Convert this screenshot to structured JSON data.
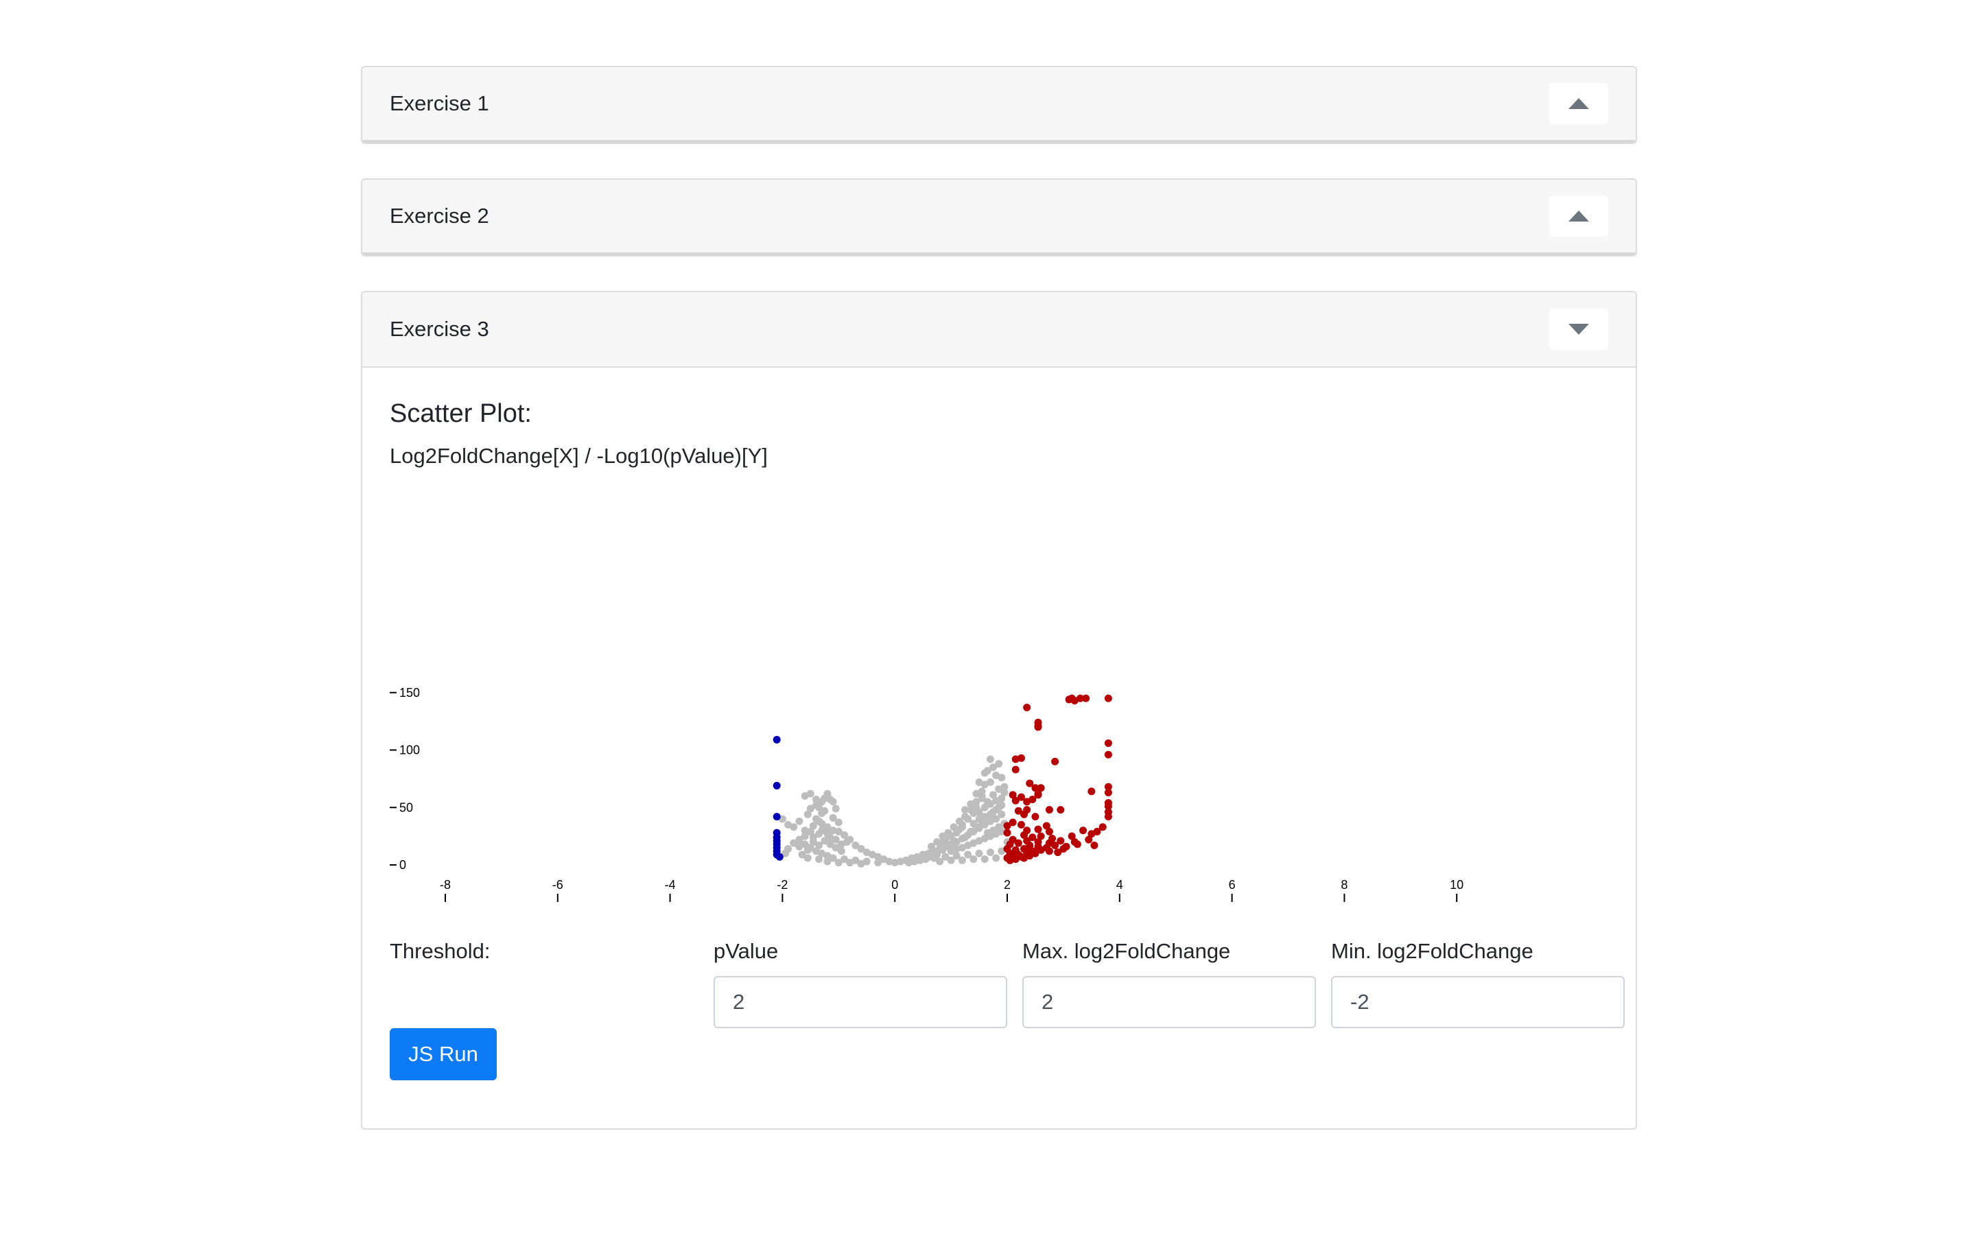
{
  "exercises": [
    {
      "title": "Exercise 1",
      "toggle_icon": "chevron-up-icon",
      "expanded": false
    },
    {
      "title": "Exercise 2",
      "toggle_icon": "chevron-up-icon",
      "expanded": false
    },
    {
      "title": "Exercise 3",
      "toggle_icon": "chevron-down-icon",
      "expanded": true
    }
  ],
  "plot": {
    "heading": "Scatter Plot:",
    "subtitle": "Log2FoldChange[X] / -Log10(pValue)[Y]"
  },
  "threshold": {
    "label": "Threshold:",
    "pvalue_label": "pValue",
    "pvalue_value": "2",
    "max_label": "Max. log2FoldChange",
    "max_value": "2",
    "min_label": "Min. log2FoldChange",
    "min_value": "-2",
    "run_label": "JS Run"
  },
  "colors": {
    "accent": "#0d7bf5",
    "not_significant": "#bdbdbd",
    "down_regulated": "#0000b8",
    "up_regulated": "#b80000"
  },
  "chart_data": {
    "type": "scatter",
    "title": "",
    "xlabel": "",
    "ylabel": "",
    "xlim": [
      -8,
      10
    ],
    "ylim": [
      0,
      150
    ],
    "x_ticks": [
      "-8",
      "-6",
      "-4",
      "-2",
      "0",
      "2",
      "4",
      "6",
      "8",
      "10"
    ],
    "y_ticks": [
      "0",
      "50",
      "100",
      "150"
    ],
    "series": [
      {
        "color": "#0000b8",
        "points": [
          [
            -2.1,
            109
          ],
          [
            -2.1,
            69
          ],
          [
            -2.1,
            42
          ],
          [
            -2.1,
            28
          ],
          [
            -2.1,
            24
          ],
          [
            -2.1,
            21
          ],
          [
            -2.1,
            18
          ],
          [
            -2.1,
            15
          ],
          [
            -2.1,
            12
          ],
          [
            -2.1,
            9
          ],
          [
            -2.05,
            7
          ]
        ]
      },
      {
        "color": "#b80000",
        "points": [
          [
            3.1,
            144
          ],
          [
            3.15,
            145
          ],
          [
            3.3,
            145
          ],
          [
            3.4,
            145
          ],
          [
            3.8,
            145
          ],
          [
            3.2,
            143
          ],
          [
            2.35,
            137
          ],
          [
            2.55,
            124
          ],
          [
            2.55,
            121
          ],
          [
            2.55,
            120
          ],
          [
            3.8,
            106
          ],
          [
            3.8,
            96
          ],
          [
            2.15,
            92
          ],
          [
            2.25,
            93
          ],
          [
            2.85,
            90
          ],
          [
            2.15,
            83
          ],
          [
            2.4,
            71
          ],
          [
            2.5,
            67
          ],
          [
            2.6,
            67
          ],
          [
            2.55,
            62
          ],
          [
            3.5,
            64
          ],
          [
            3.8,
            68
          ],
          [
            3.8,
            63
          ],
          [
            2.1,
            61
          ],
          [
            2.25,
            59
          ],
          [
            2.35,
            55
          ],
          [
            2.45,
            57
          ],
          [
            2.55,
            61
          ],
          [
            2.15,
            56
          ],
          [
            3.8,
            54
          ],
          [
            3.8,
            51
          ],
          [
            2.2,
            47
          ],
          [
            2.35,
            48
          ],
          [
            2.75,
            48
          ],
          [
            2.95,
            48
          ],
          [
            3.8,
            46
          ],
          [
            2.3,
            44
          ],
          [
            2.5,
            42
          ],
          [
            3.8,
            42
          ],
          [
            2.1,
            37
          ],
          [
            2.25,
            35
          ],
          [
            3.7,
            33
          ],
          [
            2.7,
            34
          ],
          [
            2.0,
            34
          ],
          [
            2.35,
            30
          ],
          [
            2.55,
            31
          ],
          [
            2.75,
            29
          ],
          [
            3.35,
            30
          ],
          [
            3.6,
            29
          ],
          [
            2.0,
            28
          ],
          [
            2.3,
            26
          ],
          [
            2.45,
            24
          ],
          [
            2.6,
            25
          ],
          [
            2.8,
            23
          ],
          [
            3.15,
            25
          ],
          [
            3.5,
            27
          ],
          [
            2.1,
            22
          ],
          [
            2.35,
            21
          ],
          [
            2.55,
            20
          ],
          [
            2.75,
            19
          ],
          [
            2.95,
            21
          ],
          [
            3.2,
            20
          ],
          [
            3.45,
            22
          ],
          [
            2.05,
            18
          ],
          [
            2.2,
            19
          ],
          [
            2.4,
            17
          ],
          [
            2.55,
            16
          ],
          [
            2.7,
            15
          ],
          [
            2.85,
            17
          ],
          [
            3.05,
            16
          ],
          [
            3.25,
            18
          ],
          [
            3.55,
            17
          ],
          [
            2.0,
            14
          ],
          [
            2.15,
            13
          ],
          [
            2.3,
            14
          ],
          [
            2.45,
            12
          ],
          [
            2.6,
            13
          ],
          [
            2.75,
            12
          ],
          [
            2.9,
            11
          ],
          [
            3.0,
            14
          ],
          [
            2.05,
            10
          ],
          [
            2.2,
            9
          ],
          [
            2.35,
            11
          ],
          [
            2.5,
            10
          ],
          [
            2.1,
            8
          ],
          [
            2.25,
            7
          ],
          [
            2.4,
            8
          ],
          [
            2.0,
            6
          ],
          [
            2.15,
            5
          ],
          [
            2.3,
            6
          ],
          [
            2.05,
            4
          ]
        ]
      },
      {
        "color": "#bdbdbd",
        "points": [
          [
            -2.0,
            40
          ],
          [
            -1.9,
            35
          ],
          [
            -1.8,
            33
          ],
          [
            -1.7,
            38
          ],
          [
            -1.6,
            30
          ],
          [
            -1.5,
            29
          ],
          [
            -1.7,
            22
          ],
          [
            -1.6,
            25
          ],
          [
            -1.8,
            19
          ],
          [
            -1.9,
            14
          ],
          [
            -1.95,
            10
          ],
          [
            -1.7,
            16
          ],
          [
            -1.55,
            13
          ],
          [
            -1.65,
            9
          ],
          [
            -1.45,
            24
          ],
          [
            -1.35,
            27
          ],
          [
            -1.55,
            44
          ],
          [
            -1.4,
            40
          ],
          [
            -1.3,
            36
          ],
          [
            -1.2,
            33
          ],
          [
            -1.35,
            50
          ],
          [
            -1.25,
            47
          ],
          [
            -1.4,
            52
          ],
          [
            -1.3,
            45
          ],
          [
            -1.5,
            49
          ],
          [
            -1.6,
            60
          ],
          [
            -1.5,
            62
          ],
          [
            -1.2,
            62
          ],
          [
            -1.15,
            57
          ],
          [
            -1.1,
            55
          ],
          [
            -1.05,
            49
          ],
          [
            -1.3,
            55
          ],
          [
            -1.25,
            58
          ],
          [
            -1.4,
            57
          ],
          [
            -1.1,
            41
          ],
          [
            -1.0,
            37
          ],
          [
            -1.0,
            29
          ],
          [
            -0.9,
            26
          ],
          [
            -0.8,
            22
          ],
          [
            -0.85,
            20
          ],
          [
            -0.7,
            17
          ],
          [
            -0.6,
            14
          ],
          [
            -0.5,
            11
          ],
          [
            -0.4,
            9
          ],
          [
            -0.3,
            7
          ],
          [
            -0.2,
            5
          ],
          [
            -0.1,
            3
          ],
          [
            0,
            2
          ],
          [
            0.1,
            3
          ],
          [
            0.2,
            4
          ],
          [
            0.3,
            6
          ],
          [
            0.4,
            7
          ],
          [
            0.5,
            9
          ],
          [
            -1.6,
            18
          ],
          [
            -1.5,
            15
          ],
          [
            -1.45,
            20
          ],
          [
            -1.35,
            17
          ],
          [
            -1.25,
            21
          ],
          [
            -1.15,
            18
          ],
          [
            -1.05,
            15
          ],
          [
            -0.95,
            12
          ],
          [
            -1.4,
            12
          ],
          [
            -1.3,
            10
          ],
          [
            -1.2,
            8
          ],
          [
            -1.1,
            6
          ],
          [
            -0.9,
            5
          ],
          [
            -0.7,
            4
          ],
          [
            -0.5,
            3
          ],
          [
            -0.3,
            2
          ],
          [
            -1.55,
            6
          ],
          [
            -1.35,
            5
          ],
          [
            -1.2,
            3
          ],
          [
            -1.0,
            2
          ],
          [
            -0.8,
            2
          ],
          [
            -0.6,
            1
          ],
          [
            -1.3,
            30
          ],
          [
            -1.2,
            27
          ],
          [
            -1.15,
            24
          ],
          [
            -1.05,
            22
          ],
          [
            -0.95,
            18
          ],
          [
            -1.45,
            34
          ],
          [
            -1.35,
            38
          ],
          [
            -1.25,
            31
          ],
          [
            -1.1,
            30
          ],
          [
            0.6,
            10
          ],
          [
            0.7,
            12
          ],
          [
            0.8,
            14
          ],
          [
            0.9,
            16
          ],
          [
            1.0,
            18
          ],
          [
            1.1,
            20
          ],
          [
            1.2,
            23
          ],
          [
            1.3,
            26
          ],
          [
            1.4,
            29
          ],
          [
            1.5,
            32
          ],
          [
            1.6,
            35
          ],
          [
            1.7,
            38
          ],
          [
            1.8,
            40
          ],
          [
            1.9,
            44
          ],
          [
            1.0,
            12
          ],
          [
            1.1,
            14
          ],
          [
            1.2,
            15
          ],
          [
            1.3,
            17
          ],
          [
            1.4,
            19
          ],
          [
            1.5,
            21
          ],
          [
            1.6,
            23
          ],
          [
            1.7,
            25
          ],
          [
            1.8,
            27
          ],
          [
            1.9,
            29
          ],
          [
            0.7,
            6
          ],
          [
            0.9,
            7
          ],
          [
            1.1,
            8
          ],
          [
            1.3,
            9
          ],
          [
            1.5,
            10
          ],
          [
            1.7,
            11
          ],
          [
            1.9,
            12
          ],
          [
            0.8,
            3
          ],
          [
            1.0,
            4
          ],
          [
            1.2,
            4
          ],
          [
            1.4,
            5
          ],
          [
            1.6,
            5
          ],
          [
            1.8,
            6
          ],
          [
            1.2,
            33
          ],
          [
            1.3,
            40
          ],
          [
            1.4,
            36
          ],
          [
            1.5,
            46
          ],
          [
            1.6,
            50
          ],
          [
            1.7,
            44
          ],
          [
            1.8,
            48
          ],
          [
            1.9,
            52
          ],
          [
            1.55,
            58
          ],
          [
            1.65,
            55
          ],
          [
            1.75,
            61
          ],
          [
            1.85,
            66
          ],
          [
            1.95,
            63
          ],
          [
            1.25,
            48
          ],
          [
            1.35,
            53
          ],
          [
            1.45,
            55
          ],
          [
            1.45,
            62
          ],
          [
            1.55,
            64
          ],
          [
            1.6,
            70
          ],
          [
            1.7,
            72
          ],
          [
            1.8,
            78
          ],
          [
            1.9,
            76
          ],
          [
            1.95,
            68
          ],
          [
            1.4,
            45
          ],
          [
            1.5,
            40
          ],
          [
            1.6,
            42
          ],
          [
            1.0,
            25
          ],
          [
            1.1,
            28
          ],
          [
            1.15,
            31
          ],
          [
            1.2,
            35
          ],
          [
            0.9,
            22
          ],
          [
            0.8,
            19
          ],
          [
            2.0,
            20
          ],
          [
            1.95,
            36
          ],
          [
            1.85,
            33
          ],
          [
            1.75,
            30
          ],
          [
            1.65,
            28
          ],
          [
            1.65,
            82
          ],
          [
            1.75,
            85
          ],
          [
            1.85,
            88
          ],
          [
            1.6,
            80
          ],
          [
            1.7,
            92
          ],
          [
            1.5,
            72
          ],
          [
            1.55,
            60
          ],
          [
            1.45,
            50
          ],
          [
            1.35,
            48
          ],
          [
            1.25,
            42
          ],
          [
            1.15,
            38
          ],
          [
            1.05,
            33
          ],
          [
            0.95,
            28
          ],
          [
            0.85,
            25
          ],
          [
            0.75,
            20
          ],
          [
            0.65,
            16
          ],
          [
            1.9,
            58
          ],
          [
            1.8,
            56
          ],
          [
            1.7,
            53
          ],
          [
            1.85,
            50
          ],
          [
            1.75,
            46
          ],
          [
            1.65,
            40
          ],
          [
            1.55,
            37
          ],
          [
            1.45,
            33
          ],
          [
            1.35,
            29
          ],
          [
            1.25,
            24
          ],
          [
            1.05,
            21
          ],
          [
            0.95,
            17
          ],
          [
            0.85,
            13
          ],
          [
            0.75,
            9
          ],
          [
            0.65,
            7
          ],
          [
            0.55,
            5
          ],
          [
            0.45,
            4
          ],
          [
            0.35,
            3
          ],
          [
            0.25,
            2
          ]
        ]
      }
    ]
  }
}
